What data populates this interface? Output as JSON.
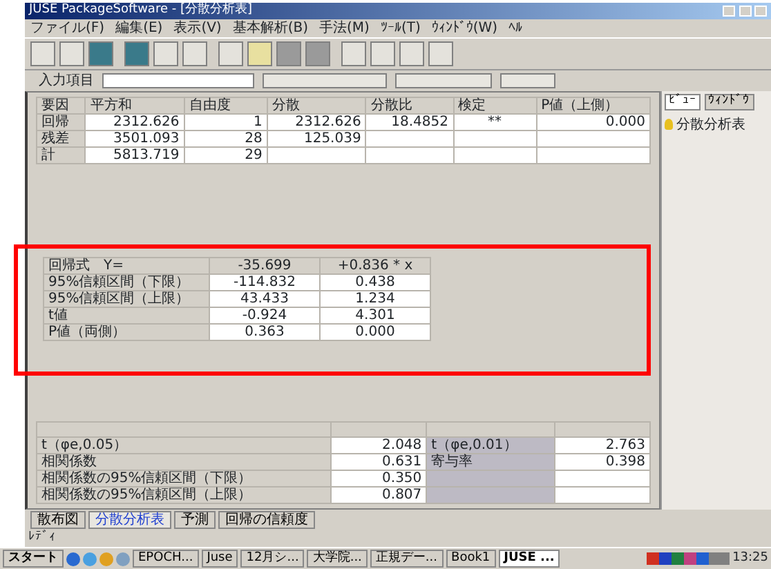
{
  "window": {
    "title": "JUSE PackageSoftware - [分散分析表]"
  },
  "menu": [
    "ファイル(F)",
    "編集(E)",
    "表示(V)",
    "基本解析(B)",
    "手法(M)",
    "ﾂｰﾙ(T)",
    "ｳｨﾝﾄﾞｳ(W)",
    "ﾍﾙ"
  ],
  "input_row": {
    "label": "入力項目"
  },
  "anova_table": {
    "columns": [
      "要因",
      "平方和",
      "自由度",
      "分散",
      "分散比",
      "検定",
      "P値（上側）"
    ],
    "rows": [
      [
        "回帰",
        "2312.626",
        "1",
        "2312.626",
        "18.4852",
        "**",
        "0.000"
      ],
      [
        "残差",
        "3501.093",
        "28",
        "125.039",
        "",
        "",
        ""
      ],
      [
        "計",
        "5813.719",
        "29",
        "",
        "",
        "",
        ""
      ]
    ]
  },
  "annotation": {
    "kind": "frame"
  },
  "regression_table": {
    "header": [
      "回帰式　Y=",
      "-35.699",
      "+0.836 * x"
    ],
    "rows": [
      [
        "95%信頼区間（下限）",
        "-114.832",
        "0.438"
      ],
      [
        "95%信頼区間（上限）",
        "43.433",
        "1.234"
      ],
      [
        "t値",
        "-0.924",
        "4.301"
      ],
      [
        "P値（両側）",
        "0.363",
        "0.000"
      ]
    ]
  },
  "stats_table": {
    "rows": [
      [
        "t（φe,0.05）",
        "2.048",
        "t（φe,0.01）",
        "2.763"
      ],
      [
        "相関係数",
        "0.631",
        "寄与率",
        "0.398"
      ],
      [
        "相関係数の95%信頼区間（下限）",
        "0.350",
        "",
        ""
      ],
      [
        "相関係数の95%信頼区間（上限）",
        "0.807",
        "",
        ""
      ]
    ]
  },
  "sheet_tabs": [
    {
      "label": "散布図",
      "selected": false
    },
    {
      "label": "分散分析表",
      "selected": true
    },
    {
      "label": "予測",
      "selected": false
    },
    {
      "label": "回帰の信頼度",
      "selected": false
    }
  ],
  "side_panel": {
    "tabs": [
      {
        "label": "ﾋﾞｭｰ",
        "selected": true
      },
      {
        "label": "ｳｨﾝﾄﾞｳ",
        "selected": false
      }
    ],
    "items": [
      "分散分析表"
    ]
  },
  "status_bar": "ﾚﾃﾞｨ",
  "taskbar": {
    "start": "スタート",
    "buttons": [
      {
        "label": "EPOCH...",
        "selected": false
      },
      {
        "label": "Juse",
        "selected": false
      },
      {
        "label": "12月シ...",
        "selected": false
      },
      {
        "label": "大学院...",
        "selected": false
      },
      {
        "label": "正規デー...",
        "selected": false
      },
      {
        "label": "Book1",
        "selected": false
      },
      {
        "label": "JUSE ...",
        "selected": true
      }
    ],
    "clock": "13:25"
  }
}
